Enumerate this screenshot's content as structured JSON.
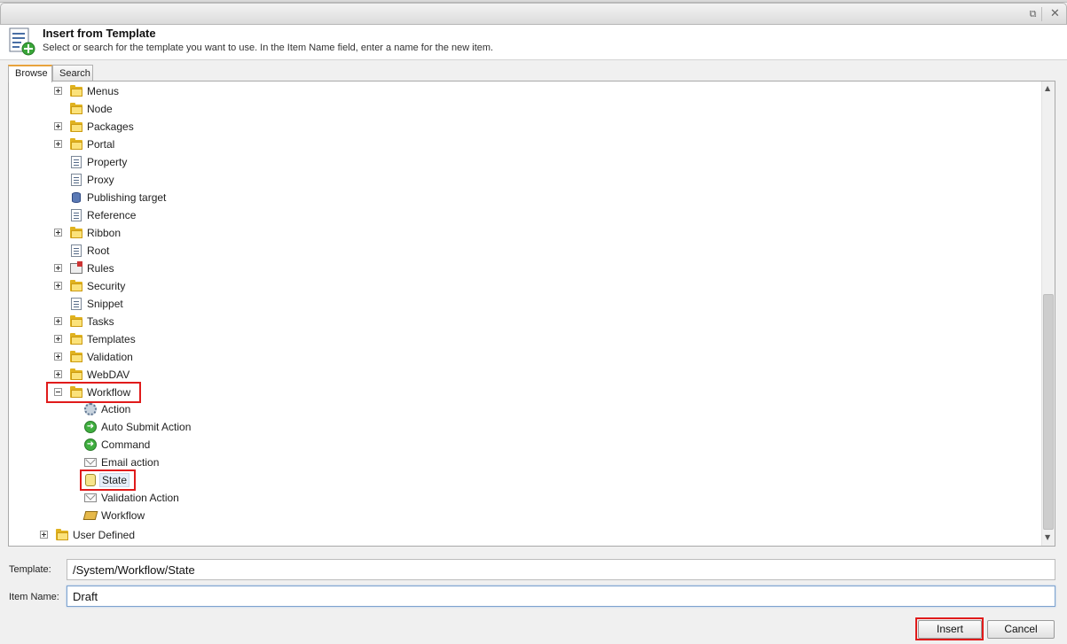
{
  "window": {
    "popout_icon": "popout-icon",
    "close_icon": "close-icon"
  },
  "header": {
    "title": "Insert from Template",
    "description": "Select or search for the template you want to use. In the Item Name field, enter a name for the new item."
  },
  "tabs": [
    {
      "label": "Browse"
    },
    {
      "label": "Search"
    }
  ],
  "tree": {
    "items": [
      {
        "label": "Menus",
        "icon": "folder-icon",
        "expander": "plus"
      },
      {
        "label": "Node",
        "icon": "folder-icon",
        "expander": "none"
      },
      {
        "label": "Packages",
        "icon": "folder-icon",
        "expander": "plus"
      },
      {
        "label": "Portal",
        "icon": "folder-icon",
        "expander": "plus"
      },
      {
        "label": "Property",
        "icon": "document-icon",
        "expander": "none"
      },
      {
        "label": "Proxy",
        "icon": "document-icon",
        "expander": "none"
      },
      {
        "label": "Publishing target",
        "icon": "database-icon",
        "expander": "none"
      },
      {
        "label": "Reference",
        "icon": "document-icon",
        "expander": "none"
      },
      {
        "label": "Ribbon",
        "icon": "folder-icon",
        "expander": "plus"
      },
      {
        "label": "Root",
        "icon": "document-icon",
        "expander": "none"
      },
      {
        "label": "Rules",
        "icon": "rules-icon",
        "expander": "plus"
      },
      {
        "label": "Security",
        "icon": "folder-icon",
        "expander": "plus"
      },
      {
        "label": "Snippet",
        "icon": "document-icon",
        "expander": "none"
      },
      {
        "label": "Tasks",
        "icon": "folder-icon",
        "expander": "plus"
      },
      {
        "label": "Templates",
        "icon": "folder-icon",
        "expander": "plus"
      },
      {
        "label": "Validation",
        "icon": "folder-icon",
        "expander": "plus"
      },
      {
        "label": "WebDAV",
        "icon": "folder-icon",
        "expander": "plus"
      },
      {
        "label": "Workflow",
        "icon": "folder-icon",
        "expander": "minus"
      }
    ],
    "workflow_children": [
      {
        "label": "Action",
        "icon": "gear-icon"
      },
      {
        "label": "Auto Submit Action",
        "icon": "green-arrow-icon"
      },
      {
        "label": "Command",
        "icon": "green-arrow-icon"
      },
      {
        "label": "Email action",
        "icon": "email-icon"
      },
      {
        "label": "State",
        "icon": "state-icon"
      },
      {
        "label": "Validation Action",
        "icon": "email-icon"
      },
      {
        "label": "Workflow",
        "icon": "workflow-icon"
      }
    ],
    "root_sibling": {
      "label": "User Defined",
      "icon": "folder-icon",
      "expander": "plus"
    }
  },
  "form": {
    "template_label": "Template:",
    "template_value": "/System/Workflow/State",
    "item_name_label": "Item Name:",
    "item_name_value": "Draft"
  },
  "buttons": {
    "insert": "Insert",
    "cancel": "Cancel"
  },
  "colors": {
    "highlight": "#e01b1b",
    "active_tab_accent": "#e8a33c"
  }
}
